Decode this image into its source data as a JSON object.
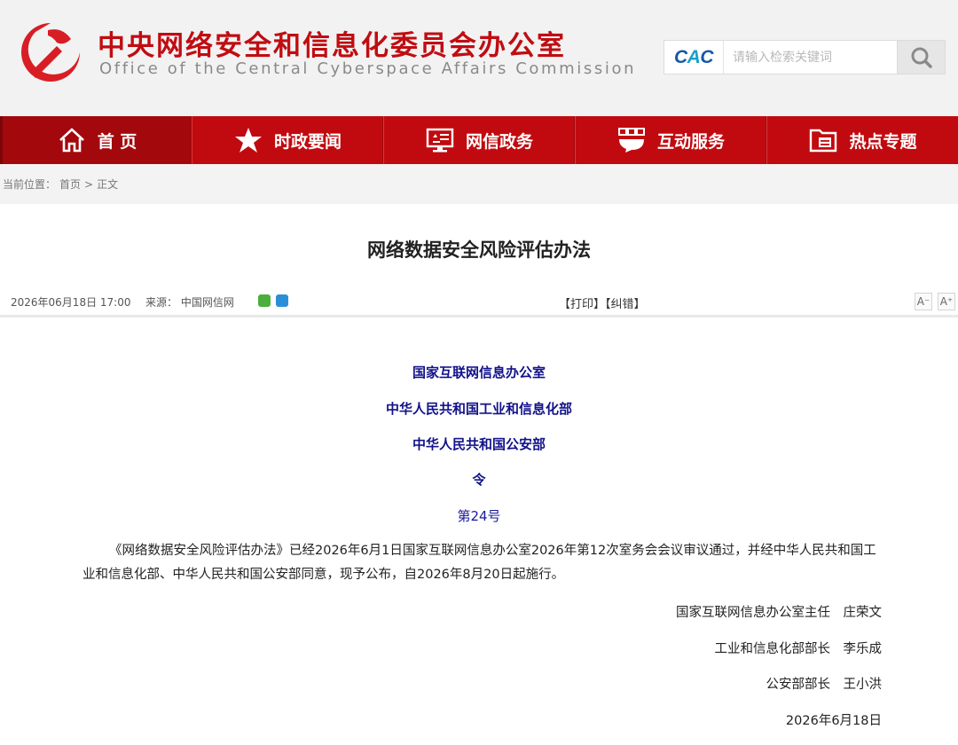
{
  "header": {
    "title_cn": "中央网络安全和信息化委员会办公室",
    "title_en": "Office of the Central Cyberspace Affairs Commission",
    "logo_icon": "party-emblem-icon",
    "accent_color": "#c00d12"
  },
  "search": {
    "logo_text_c1": "C",
    "logo_text_a": "A",
    "logo_text_c2": "C",
    "placeholder": "请输入检索关键词",
    "button_icon": "search-icon"
  },
  "nav": {
    "items": [
      {
        "label": "首 页",
        "icon": "home-icon"
      },
      {
        "label": "时政要闻",
        "icon": "star-icon"
      },
      {
        "label": "网信政务",
        "icon": "monitor-icon"
      },
      {
        "label": "互动服务",
        "icon": "chat-icon"
      },
      {
        "label": "热点专题",
        "icon": "folder-icon"
      }
    ]
  },
  "breadcrumb": {
    "prefix": "当前位置：",
    "home": "首页",
    "separator": ">",
    "current": "正文"
  },
  "article": {
    "title": "网络数据安全风险评估办法",
    "date": "2026年06月18日 17:00",
    "source_label": "来源：",
    "source": "中国网信网",
    "print": "【打印】",
    "correct": "【纠错】",
    "font_smaller": "A⁻",
    "font_larger": "A⁺",
    "issuers": [
      "国家互联网信息办公室",
      "中华人民共和国工业和信息化部",
      "中华人民共和国公安部"
    ],
    "order": "令",
    "order_number": "第24号",
    "paragraph": "《网络数据安全风险评估办法》已经2026年6月1日国家互联网信息办公室2026年第12次室务会会议审议通过，并经中华人民共和国工业和信息化部、中华人民共和国公安部同意，现予公布，自2026年8月20日起施行。",
    "signatures": [
      "国家互联网信息办公室主任　庄荣文",
      "工业和信息化部部长　李乐成",
      "公安部部长　王小洪",
      "2026年6月18日"
    ]
  }
}
